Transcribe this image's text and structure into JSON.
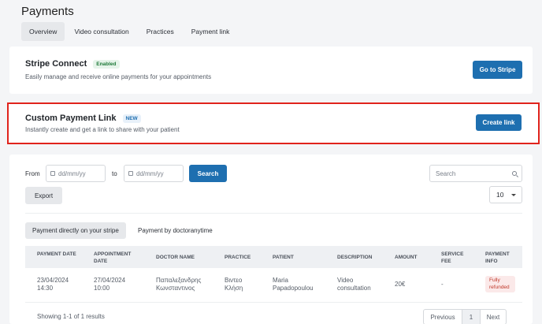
{
  "page": {
    "title": "Payments",
    "tabs": [
      "Overview",
      "Video consultation",
      "Practices",
      "Payment link"
    ]
  },
  "stripe": {
    "title": "Stripe Connect",
    "badge": "Enabled",
    "description": "Easily manage and receive online payments for your appointments",
    "button": "Go to Stripe"
  },
  "custom_link": {
    "title": "Custom Payment Link",
    "badge": "NEW",
    "description": "Instantly create and get a link to share with your patient",
    "button": "Create link"
  },
  "filters": {
    "from_label": "From",
    "to_label": "to",
    "date_placeholder": "dd/mm/yy",
    "search_button": "Search",
    "search_placeholder": "Search",
    "export_button": "Export",
    "page_size": "10"
  },
  "subtabs": [
    "Payment directly on your stripe",
    "Payment by doctoranytime"
  ],
  "table": {
    "headers": [
      "PAYMENT DATE",
      "APPOINTMENT DATE",
      "DOCTOR NAME",
      "PRACTICE",
      "PATIENT",
      "DESCRIPTION",
      "AMOUNT",
      "SERVICE FEE",
      "PAYMENT INFO"
    ],
    "rows": [
      {
        "payment_date": "23/04/2024 14:30",
        "appointment_date": "27/04/2024 10:00",
        "doctor_name": "Παπαλεξανδρης Κωνσταντινος",
        "practice": "Βιντεο Κλήση",
        "patient": "Maria Papadopoulou",
        "description": "Video consultation",
        "amount": "20€",
        "service_fee": "-",
        "payment_info": "Fully refunded"
      }
    ]
  },
  "pagination": {
    "summary": "Showing 1-1 of 1 results",
    "previous": "Previous",
    "current": "1",
    "next": "Next"
  },
  "colors": {
    "primary": "#1e6fb0",
    "highlight_border": "#e0231c",
    "enabled_badge": "#1f7a3a",
    "refund_badge": "#c0392b"
  }
}
